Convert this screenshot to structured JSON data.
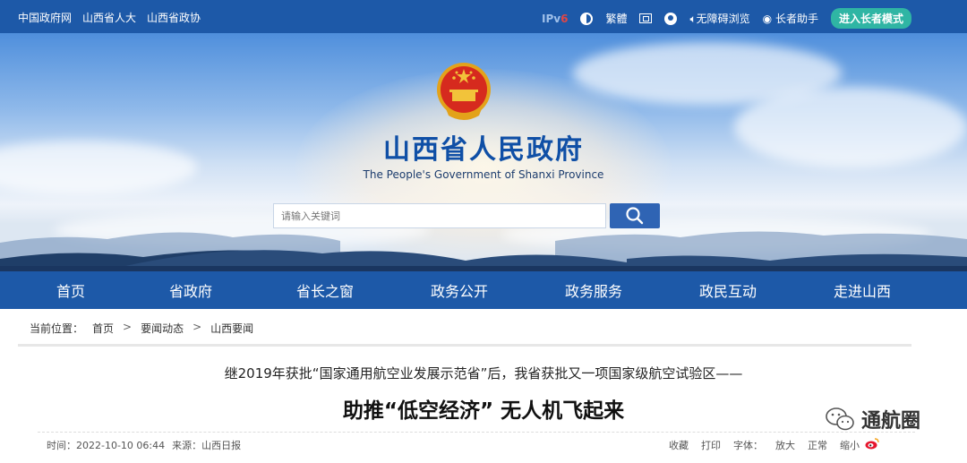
{
  "topbar": {
    "left_links": [
      "中国政府网",
      "山西省人大",
      "山西省政协"
    ],
    "ipv6_label": "IPv",
    "ipv6_suffix": "6",
    "traditional_label": "繁體",
    "accessibility_label": "无障碍浏览",
    "elder_assist_label": "长者助手",
    "elder_mode_label": "进入长者模式"
  },
  "hero": {
    "title": "山西省人民政府",
    "subtitle": "The People's Government of Shanxi Province",
    "search_placeholder": "请输入关键词"
  },
  "nav": {
    "items": [
      "首页",
      "省政府",
      "省长之窗",
      "政务公开",
      "政务服务",
      "政民互动",
      "走进山西"
    ]
  },
  "breadcrumb": {
    "prefix": "当前位置：",
    "items": [
      "首页",
      "要闻动态",
      "山西要闻"
    ],
    "separator": ">"
  },
  "article": {
    "kicker": "继2019年获批“国家通用航空业发展示范省”后，我省获批又一项国家级航空试验区——",
    "headline": "助推“低空经济” 无人机飞起来",
    "time": "时间：2022-10-10 06:44",
    "source": "来源：山西日报",
    "actions": [
      "收藏",
      "打印",
      "字体：",
      "放大",
      "正常",
      "缩小"
    ]
  },
  "watermark": {
    "text": "通航圈"
  },
  "colors": {
    "brand_blue": "#1d59a8",
    "title_blue": "#0f4fa6",
    "elder_green": "#2fb5a4"
  }
}
